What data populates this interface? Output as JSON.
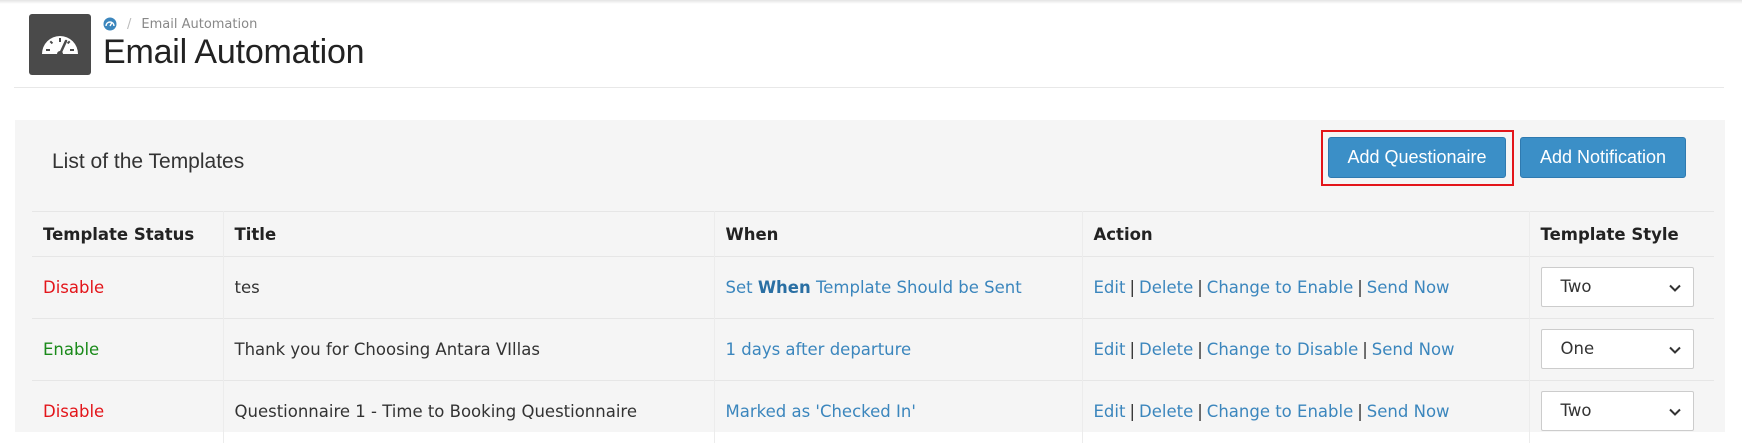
{
  "breadcrumb": {
    "current": "Email Automation",
    "separator": "/"
  },
  "header": {
    "title": "Email Automation",
    "logo_icon": "dashboard-gauge-icon"
  },
  "panel": {
    "title": "List of the Templates",
    "add_questionnaire_label": "Add Questionaire",
    "add_notification_label": "Add Notification"
  },
  "table": {
    "columns": [
      "Template Status",
      "Title",
      "When",
      "Action",
      "Template Style"
    ],
    "rows": [
      {
        "status": "Disable",
        "title": "tes",
        "when_prefix": "Set ",
        "when_bold": "When",
        "when_suffix": " Template Should be Sent",
        "actions": [
          "Edit",
          "Delete",
          "Change to Enable",
          "Send Now"
        ],
        "style": "Two"
      },
      {
        "status": "Enable",
        "title": "Thank you for Choosing Antara VIllas",
        "when_prefix": "1 days after departure",
        "when_bold": "",
        "when_suffix": "",
        "actions": [
          "Edit",
          "Delete",
          "Change to Disable",
          "Send Now"
        ],
        "style": "One"
      },
      {
        "status": "Disable",
        "title": "Questionnaire 1 - Time to Booking Questionnaire",
        "when_prefix": "Marked as 'Checked In'",
        "when_bold": "",
        "when_suffix": "",
        "actions": [
          "Edit",
          "Delete",
          "Change to Enable",
          "Send Now"
        ],
        "style": "Two"
      }
    ]
  },
  "colors": {
    "accent": "#3b8fc7",
    "disable": "#e3151a",
    "enable": "#1a8a1a",
    "link": "#3b86bd",
    "highlight_box": "#e3151a"
  }
}
